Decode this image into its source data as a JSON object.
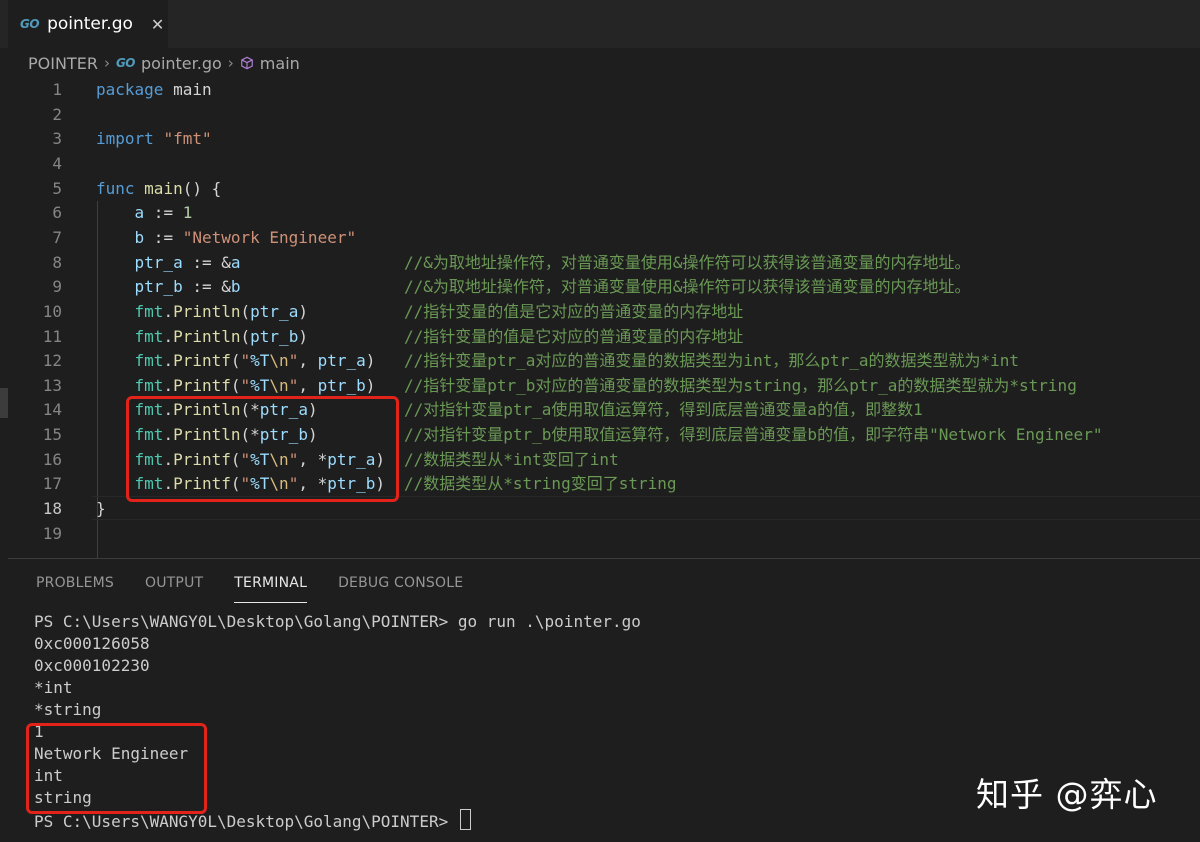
{
  "tab": {
    "icon": "go-icon",
    "icon_text": "GO",
    "title": "pointer.go",
    "close": "✕"
  },
  "breadcrumb": [
    {
      "label": "POINTER"
    },
    {
      "label": "pointer.go"
    },
    {
      "label": "main"
    }
  ],
  "editor": {
    "lines": [
      {
        "n": "1",
        "code": [
          [
            "kw",
            "package"
          ],
          [
            "plain",
            " main"
          ]
        ]
      },
      {
        "n": "2",
        "code": []
      },
      {
        "n": "3",
        "code": [
          [
            "kw",
            "import"
          ],
          [
            "plain",
            " "
          ],
          [
            "str",
            "\"fmt\""
          ]
        ]
      },
      {
        "n": "4",
        "code": []
      },
      {
        "n": "5",
        "code": [
          [
            "kw",
            "func"
          ],
          [
            "plain",
            " "
          ],
          [
            "fn",
            "main"
          ],
          [
            "plain",
            "() {"
          ]
        ]
      },
      {
        "n": "6",
        "code": [
          [
            "plain",
            "    "
          ],
          [
            "var",
            "a"
          ],
          [
            "plain",
            " := "
          ],
          [
            "num",
            "1"
          ]
        ]
      },
      {
        "n": "7",
        "code": [
          [
            "plain",
            "    "
          ],
          [
            "var",
            "b"
          ],
          [
            "plain",
            " := "
          ],
          [
            "str",
            "\"Network Engineer\""
          ]
        ]
      },
      {
        "n": "8",
        "code": [
          [
            "plain",
            "    "
          ],
          [
            "var",
            "ptr_a"
          ],
          [
            "plain",
            " := &"
          ],
          [
            "var",
            "a"
          ]
        ],
        "comment": "//&为取地址操作符，对普通变量使用&操作符可以获得该普通变量的内存地址。"
      },
      {
        "n": "9",
        "code": [
          [
            "plain",
            "    "
          ],
          [
            "var",
            "ptr_b"
          ],
          [
            "plain",
            " := &"
          ],
          [
            "var",
            "b"
          ]
        ],
        "comment": "//&为取地址操作符，对普通变量使用&操作符可以获得该普通变量的内存地址。"
      },
      {
        "n": "10",
        "code": [
          [
            "plain",
            "    "
          ],
          [
            "pkg",
            "fmt"
          ],
          [
            "plain",
            "."
          ],
          [
            "fn",
            "Println"
          ],
          [
            "plain",
            "("
          ],
          [
            "var",
            "ptr_a"
          ],
          [
            "plain",
            ")"
          ]
        ],
        "comment": "//指针变量的值是它对应的普通变量的内存地址"
      },
      {
        "n": "11",
        "code": [
          [
            "plain",
            "    "
          ],
          [
            "pkg",
            "fmt"
          ],
          [
            "plain",
            "."
          ],
          [
            "fn",
            "Println"
          ],
          [
            "plain",
            "("
          ],
          [
            "var",
            "ptr_b"
          ],
          [
            "plain",
            ")"
          ]
        ],
        "comment": "//指针变量的值是它对应的普通变量的内存地址"
      },
      {
        "n": "12",
        "code": [
          [
            "plain",
            "    "
          ],
          [
            "pkg",
            "fmt"
          ],
          [
            "plain",
            "."
          ],
          [
            "fn",
            "Printf"
          ],
          [
            "plain",
            "("
          ],
          [
            "str",
            "\""
          ],
          [
            "var",
            "%T"
          ],
          [
            "esc",
            "\\n"
          ],
          [
            "str",
            "\""
          ],
          [
            "plain",
            ", "
          ],
          [
            "var",
            "ptr_a"
          ],
          [
            "plain",
            ")"
          ]
        ],
        "comment": "//指针变量ptr_a对应的普通变量的数据类型为int，那么ptr_a的数据类型就为*int"
      },
      {
        "n": "13",
        "code": [
          [
            "plain",
            "    "
          ],
          [
            "pkg",
            "fmt"
          ],
          [
            "plain",
            "."
          ],
          [
            "fn",
            "Printf"
          ],
          [
            "plain",
            "("
          ],
          [
            "str",
            "\""
          ],
          [
            "var",
            "%T"
          ],
          [
            "esc",
            "\\n"
          ],
          [
            "str",
            "\""
          ],
          [
            "plain",
            ", "
          ],
          [
            "var",
            "ptr_b"
          ],
          [
            "plain",
            ")"
          ]
        ],
        "comment": "//指针变量ptr_b对应的普通变量的数据类型为string，那么ptr_a的数据类型就为*string"
      },
      {
        "n": "14",
        "code": [
          [
            "plain",
            "    "
          ],
          [
            "pkg",
            "fmt"
          ],
          [
            "plain",
            "."
          ],
          [
            "fn",
            "Println"
          ],
          [
            "plain",
            "(*"
          ],
          [
            "var",
            "ptr_a"
          ],
          [
            "plain",
            ")"
          ]
        ],
        "comment": "//对指针变量ptr_a使用取值运算符，得到底层普通变量a的值，即整数1"
      },
      {
        "n": "15",
        "code": [
          [
            "plain",
            "    "
          ],
          [
            "pkg",
            "fmt"
          ],
          [
            "plain",
            "."
          ],
          [
            "fn",
            "Println"
          ],
          [
            "plain",
            "(*"
          ],
          [
            "var",
            "ptr_b"
          ],
          [
            "plain",
            ")"
          ]
        ],
        "comment": "//对指针变量ptr_b使用取值运算符，得到底层普通变量b的值，即字符串\"Network Engineer\""
      },
      {
        "n": "16",
        "code": [
          [
            "plain",
            "    "
          ],
          [
            "pkg",
            "fmt"
          ],
          [
            "plain",
            "."
          ],
          [
            "fn",
            "Printf"
          ],
          [
            "plain",
            "("
          ],
          [
            "str",
            "\""
          ],
          [
            "var",
            "%T"
          ],
          [
            "esc",
            "\\n"
          ],
          [
            "str",
            "\""
          ],
          [
            "plain",
            ", *"
          ],
          [
            "var",
            "ptr_a"
          ],
          [
            "plain",
            ")"
          ]
        ],
        "comment": "//数据类型从*int变回了int"
      },
      {
        "n": "17",
        "code": [
          [
            "plain",
            "    "
          ],
          [
            "pkg",
            "fmt"
          ],
          [
            "plain",
            "."
          ],
          [
            "fn",
            "Printf"
          ],
          [
            "plain",
            "("
          ],
          [
            "str",
            "\""
          ],
          [
            "var",
            "%T"
          ],
          [
            "esc",
            "\\n"
          ],
          [
            "str",
            "\""
          ],
          [
            "plain",
            ", *"
          ],
          [
            "var",
            "ptr_b"
          ],
          [
            "plain",
            ")"
          ]
        ],
        "comment": "//数据类型从*string变回了string"
      },
      {
        "n": "18",
        "code": [
          [
            "plain",
            "}"
          ]
        ],
        "active": true
      },
      {
        "n": "19",
        "code": []
      }
    ]
  },
  "panel": {
    "tabs": [
      "PROBLEMS",
      "OUTPUT",
      "TERMINAL",
      "DEBUG CONSOLE"
    ],
    "active_tab": "TERMINAL",
    "terminal": [
      "PS C:\\Users\\WANGY0L\\Desktop\\Golang\\POINTER> go run .\\pointer.go",
      "0xc000126058",
      "0xc000102230",
      "*int",
      "*string",
      "1",
      "Network Engineer",
      "int",
      "string",
      "PS C:\\Users\\WANGY0L\\Desktop\\Golang\\POINTER> "
    ]
  },
  "watermark": "知乎 @弈心",
  "colors": {
    "background": "#1e1e1e",
    "keyword": "#569cd6",
    "string": "#ce9178",
    "number": "#b5cea8",
    "function": "#dcdcaa",
    "package": "#4ec9b0",
    "variable": "#9cdcfe",
    "comment": "#6a9955",
    "highlight_box": "#e2231a"
  }
}
